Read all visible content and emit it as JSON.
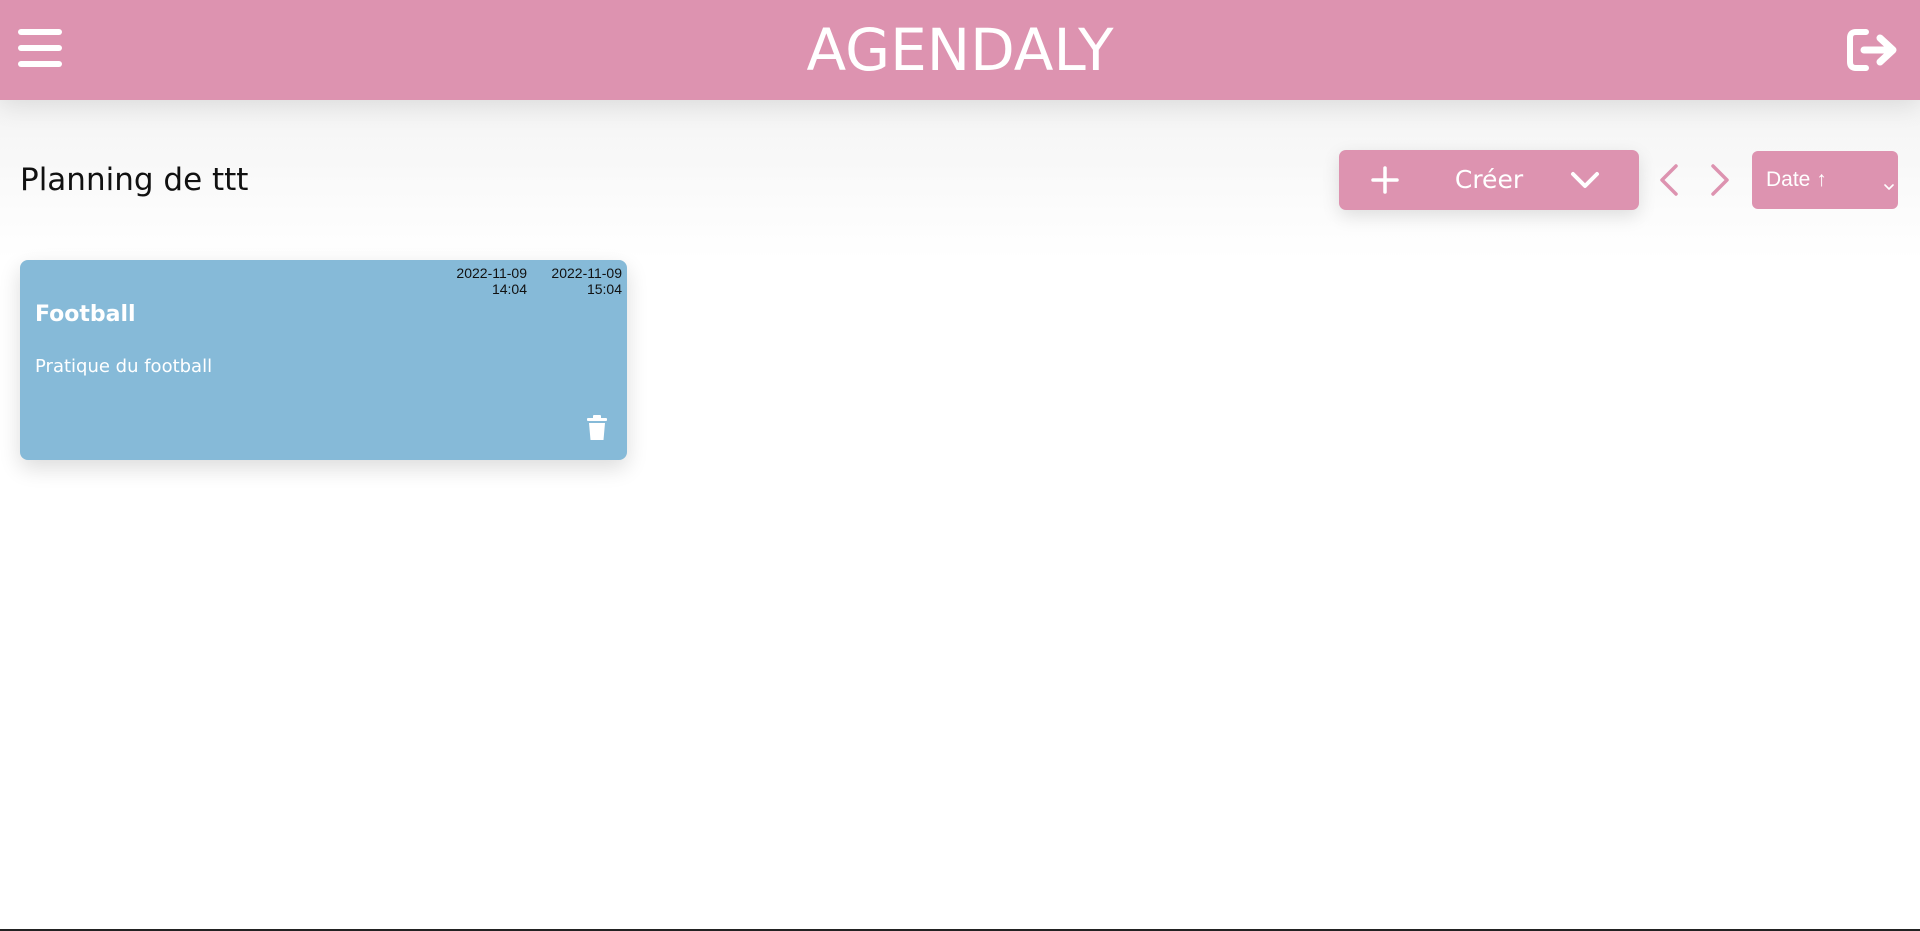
{
  "header": {
    "title": "AGENDALY",
    "menu_icon": "hamburger-menu-icon",
    "logout_icon": "logout-arrow-icon"
  },
  "toolbar": {
    "page_title": "Planning de ttt",
    "create_label": "Créer",
    "create_icon": "plus-icon",
    "create_dropdown_icon": "chevron-down-icon",
    "prev_icon": "chevron-left-icon",
    "next_icon": "chevron-right-icon",
    "sort_value": "Date ↑",
    "sort_caret_icon": "caret-down-icon"
  },
  "events": [
    {
      "title": "Football",
      "description": "Pratique du football",
      "start_date": "2022-11-09",
      "start_time": "14:04",
      "end_date": "2022-11-09",
      "end_time": "15:04",
      "delete_icon": "trash-icon"
    }
  ],
  "colors": {
    "brand_pink": "#dd93b0",
    "card_blue": "#86bad8",
    "white": "#ffffff"
  }
}
